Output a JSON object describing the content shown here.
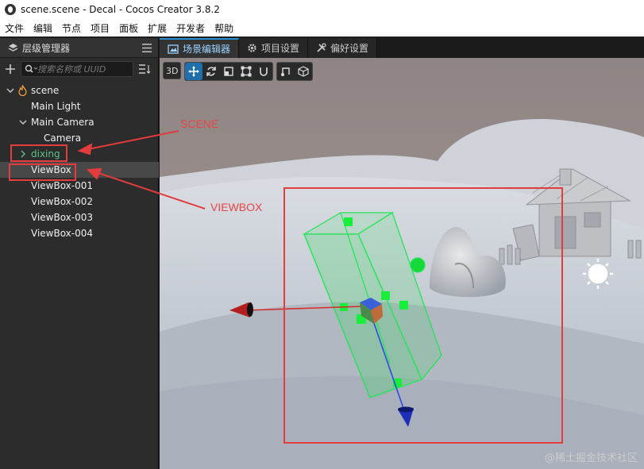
{
  "window": {
    "title": "scene.scene - Decal - Cocos Creator 3.8.2"
  },
  "menu": [
    "文件",
    "编辑",
    "节点",
    "项目",
    "面板",
    "扩展",
    "开发者",
    "帮助"
  ],
  "hierarchy": {
    "title": "层级管理器",
    "search_placeholder": "搜索名称或 UUID",
    "nodes": [
      {
        "label": "scene",
        "icon": "flame-icon",
        "expanded": true
      },
      {
        "label": "Main Light"
      },
      {
        "label": "Main Camera",
        "expanded": true
      },
      {
        "label": "Camera"
      },
      {
        "label": "dixing",
        "expanded": false
      },
      {
        "label": "ViewBox",
        "selected": true
      },
      {
        "label": "ViewBox-001"
      },
      {
        "label": "ViewBox-002"
      },
      {
        "label": "ViewBox-003"
      },
      {
        "label": "ViewBox-004"
      }
    ]
  },
  "tabs": [
    {
      "label": "场景编辑器",
      "icon": "scene-icon",
      "active": true
    },
    {
      "label": "项目设置",
      "icon": "gear-icon"
    },
    {
      "label": "偏好设置",
      "icon": "tools-icon"
    }
  ],
  "viewport_toolbar": {
    "mode": "3D",
    "tools": [
      "move-tool-icon",
      "rotate-tool-icon",
      "scale-tool-icon",
      "rect-tool-icon",
      "snap-tool-icon"
    ],
    "extra": [
      "anchor-icon",
      "cube-icon"
    ]
  },
  "annotations": {
    "scene_label": "SCENE",
    "viewbox_label": "VIEWBOX",
    "color": "#e23c3c"
  },
  "watermark": "@稀土掘金技术社区",
  "colors": {
    "accent": "#2b8dd6",
    "selection": "#484848",
    "dixing": "#5bc28a"
  }
}
